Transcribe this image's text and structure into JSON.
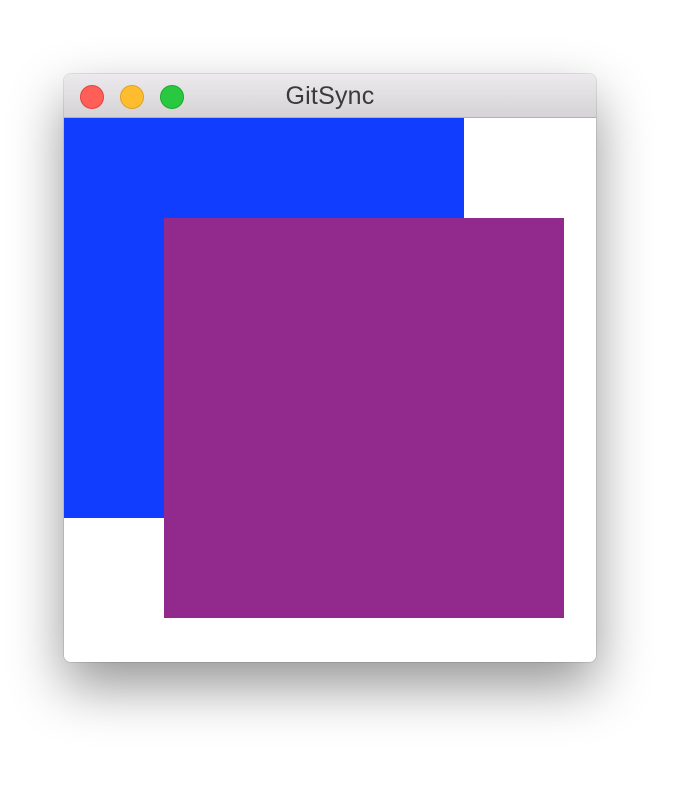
{
  "window": {
    "title": "GitSync"
  },
  "traffic_lights": {
    "close": {
      "icon": "close-icon",
      "color": "#ff5f57",
      "border": "#e0443e"
    },
    "minimize": {
      "icon": "minimize-icon",
      "color": "#febc2e",
      "border": "#dea123"
    },
    "zoom": {
      "icon": "zoom-icon",
      "color": "#28c840",
      "border": "#1aab29"
    }
  },
  "content": {
    "background": "#ffffff",
    "back_square_color": "#113dff",
    "front_square_color": "#912a8c"
  }
}
